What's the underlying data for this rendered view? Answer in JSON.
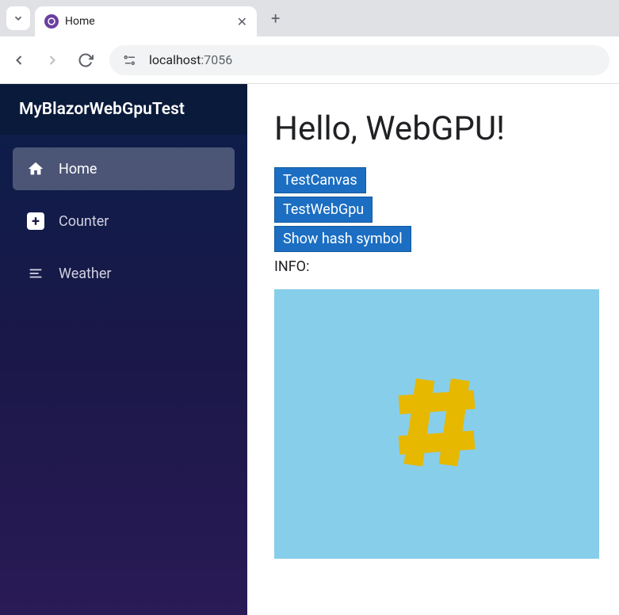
{
  "browser": {
    "tab_title": "Home",
    "url_host": "localhost",
    "url_port": ":7056"
  },
  "sidebar": {
    "title": "MyBlazorWebGpuTest",
    "items": [
      {
        "label": "Home"
      },
      {
        "label": "Counter"
      },
      {
        "label": "Weather"
      }
    ]
  },
  "main": {
    "heading": "Hello, WebGPU!",
    "buttons": [
      {
        "label": "TestCanvas"
      },
      {
        "label": "TestWebGpu"
      },
      {
        "label": "Show hash symbol"
      }
    ],
    "info_label": "INFO:",
    "canvas": {
      "bg_color": "#87ceeb",
      "symbol_color": "#e6b800"
    }
  }
}
